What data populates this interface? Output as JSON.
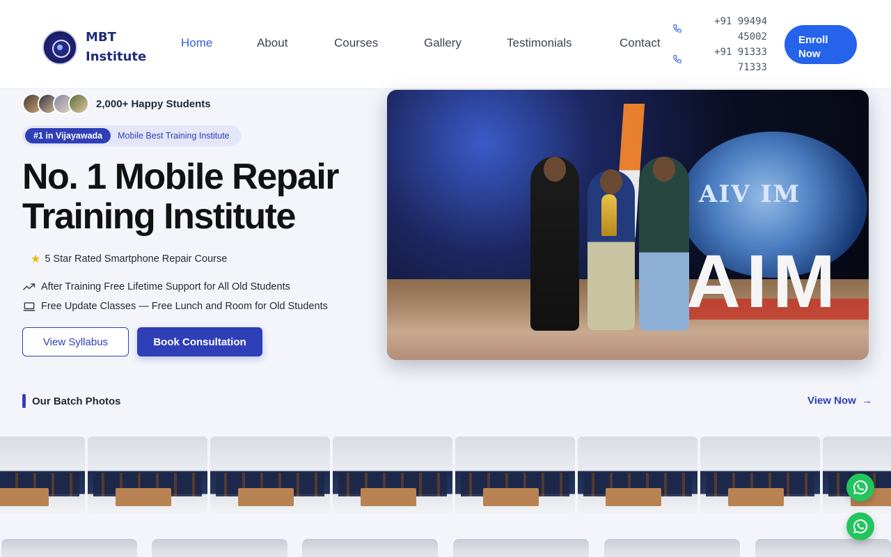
{
  "header": {
    "logo_line1": "MBT",
    "logo_line2": "Institute",
    "nav": [
      {
        "label": "Home",
        "active": true
      },
      {
        "label": "About",
        "active": false
      },
      {
        "label": "Courses",
        "active": false
      },
      {
        "label": "Gallery",
        "active": false
      },
      {
        "label": "Testimonials",
        "active": false
      },
      {
        "label": "Contact",
        "active": false
      }
    ],
    "phones": [
      {
        "line1": "+91 99494",
        "line2": "45002"
      },
      {
        "line1": "+91 91333",
        "line2": "71333"
      }
    ],
    "enroll_line1": "Enroll",
    "enroll_line2": "Now"
  },
  "hero": {
    "students_text": "2,000+ Happy Students",
    "badge_pill": "#1 in Vijayawada",
    "badge_text": "Mobile Best Training Institute",
    "title_line1": "No. 1 Mobile Repair",
    "title_line2": "Training Institute",
    "rating_text": "5 Star Rated Smartphone Repair Course",
    "features": [
      "After Training Free Lifetime Support for All Old Students",
      "Free Update Classes — Free Lunch and Room for Old Students"
    ],
    "btn_syllabus": "View Syllabus",
    "btn_consult": "Book Consultation",
    "photo_text_globe": "AIV IM",
    "photo_text_stage": "AIM"
  },
  "batch": {
    "title": "Our Batch Photos",
    "view_now": "View Now"
  },
  "colors": {
    "primary": "#2f3fb8",
    "accent_blue": "#2563eb",
    "whatsapp": "#22c55e",
    "star": "#f5b301"
  },
  "icons": [
    "phone-icon",
    "star-icon",
    "trend-icon",
    "laptop-icon",
    "arrow-right-icon",
    "whatsapp-icon"
  ]
}
